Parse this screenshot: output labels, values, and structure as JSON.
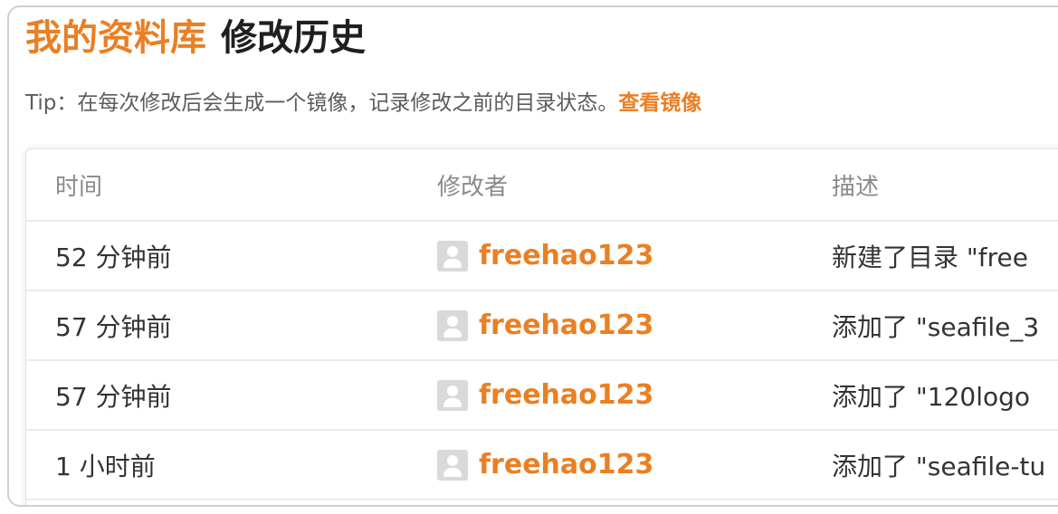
{
  "heading": {
    "library": "我的资料库",
    "title": "修改历史"
  },
  "tip": {
    "prefix": "Tip",
    "text": "：在每次修改后会生成一个镜像，记录修改之前的目录状态。",
    "link": "查看镜像"
  },
  "table": {
    "columns": [
      "时间",
      "修改者",
      "描述"
    ],
    "rows": [
      {
        "time": "52 分钟前",
        "user": "freehao123",
        "desc": "新建了目录 \"free"
      },
      {
        "time": "57 分钟前",
        "user": "freehao123",
        "desc": "添加了 \"seafile_3"
      },
      {
        "time": "57 分钟前",
        "user": "freehao123",
        "desc": "添加了 \"120logo"
      },
      {
        "time": "1 小时前",
        "user": "freehao123",
        "desc": "添加了 \"seafile-tu"
      }
    ]
  },
  "colors": {
    "accent": "#ea7f23",
    "text": "#333333",
    "muted": "#8a8a8a",
    "border": "#ececec"
  },
  "icons": {
    "avatar": "user-avatar-icon"
  }
}
